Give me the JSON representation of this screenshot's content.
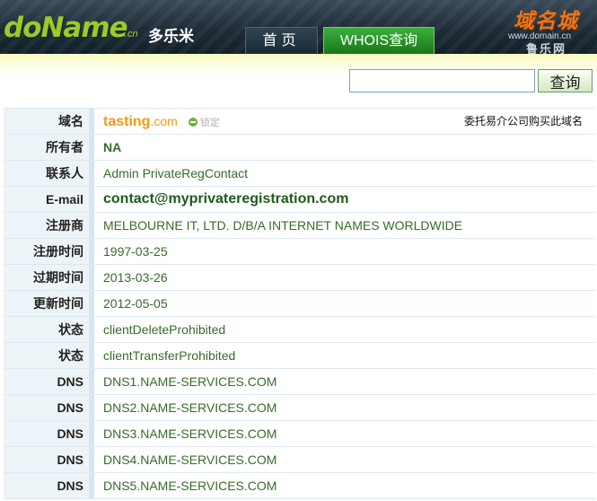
{
  "header": {
    "logo": "doName",
    "logo_cn": ".cn",
    "logo_chinese": "多乐米",
    "nav": [
      {
        "label": "首页"
      },
      {
        "label": "WHOIS查询"
      }
    ],
    "watermark": {
      "main": "域名城",
      "url": "www.domain.cn",
      "sub": "鲁乐网"
    }
  },
  "search": {
    "value": "",
    "placeholder": "",
    "button_label": "查询"
  },
  "domain": {
    "label": "域名",
    "name": "tasting",
    "ext": ".com",
    "lock_text": "锁定",
    "buy_link": "委托易介公司购买此域名"
  },
  "fields": [
    {
      "label": "所有者",
      "value": "NA",
      "style": "bold"
    },
    {
      "label": "联系人",
      "value": "Admin PrivateRegContact",
      "style": ""
    },
    {
      "label": "E-mail",
      "value": "contact@myprivateregistration.com",
      "style": "email"
    },
    {
      "label": "注册商",
      "value": "MELBOURNE IT, LTD. D/B/A INTERNET NAMES WORLDWIDE",
      "style": ""
    },
    {
      "label": "注册时间",
      "value": "1997-03-25",
      "style": ""
    },
    {
      "label": "过期时间",
      "value": "2013-03-26",
      "style": ""
    },
    {
      "label": "更新时间",
      "value": "2012-05-05",
      "style": ""
    },
    {
      "label": "状态",
      "value": "clientDeleteProhibited",
      "style": ""
    },
    {
      "label": "状态",
      "value": "clientTransferProhibited",
      "style": ""
    },
    {
      "label": "DNS",
      "value": "DNS1.NAME-SERVICES.COM",
      "style": ""
    },
    {
      "label": "DNS",
      "value": "DNS2.NAME-SERVICES.COM",
      "style": ""
    },
    {
      "label": "DNS",
      "value": "DNS3.NAME-SERVICES.COM",
      "style": ""
    },
    {
      "label": "DNS",
      "value": "DNS4.NAME-SERVICES.COM",
      "style": ""
    },
    {
      "label": "DNS",
      "value": "DNS5.NAME-SERVICES.COM",
      "style": ""
    }
  ],
  "colors": {
    "brand_green": "#9acb2a",
    "header_dark": "#1e2c38",
    "value_green": "#386a2b",
    "domain_orange": "#f09a16",
    "label_bg": "#edf4f8"
  }
}
